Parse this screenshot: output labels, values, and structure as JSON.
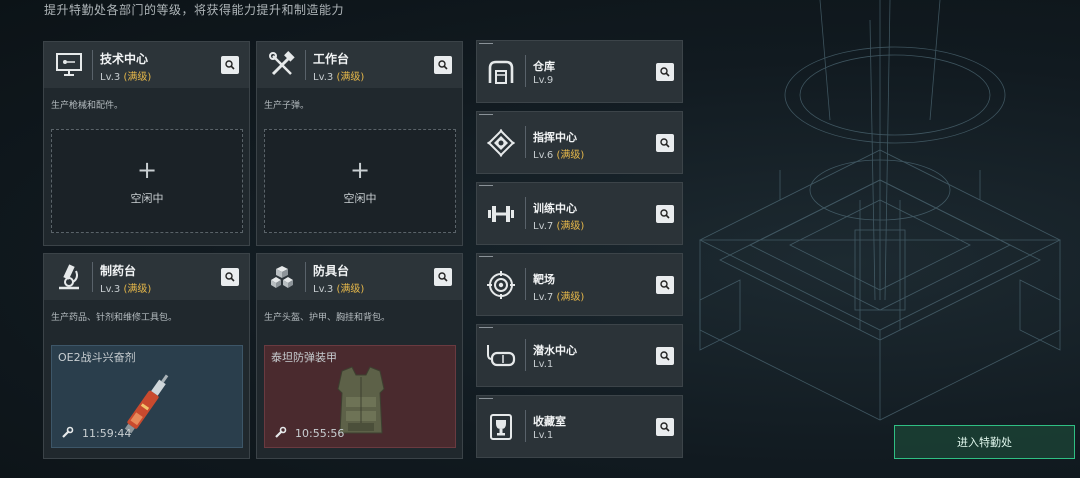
{
  "subtitle": "提升特勤处各部门的等级，将获得能力提升和制造能力",
  "cards": [
    {
      "name": "技术中心",
      "level": "Lv.3",
      "max": "(满级)",
      "desc": "生产枪械和配件。",
      "slot_text": "空闲中",
      "icon": "computer-icon"
    },
    {
      "name": "工作台",
      "level": "Lv.3",
      "max": "(满级)",
      "desc": "生产子弹。",
      "slot_text": "空闲中",
      "icon": "tools-icon"
    },
    {
      "name": "制药台",
      "level": "Lv.3",
      "max": "(满级)",
      "desc": "生产药品、针剂和维修工具包。",
      "product": "OE2战斗兴奋剂",
      "timer": "11:59:44",
      "icon": "microscope-icon"
    },
    {
      "name": "防具台",
      "level": "Lv.3",
      "max": "(满级)",
      "desc": "生产头盔、护甲、胸挂和背包。",
      "product": "泰坦防弹装甲",
      "timer": "10:55:56",
      "icon": "armor-blocks-icon"
    }
  ],
  "right_list": [
    {
      "name": "仓库",
      "level": "Lv.9",
      "max": "",
      "icon": "warehouse-icon"
    },
    {
      "name": "指挥中心",
      "level": "Lv.6",
      "max": "(满级)",
      "icon": "command-icon"
    },
    {
      "name": "训练中心",
      "level": "Lv.7",
      "max": "(满级)",
      "icon": "dumbbell-icon"
    },
    {
      "name": "靶场",
      "level": "Lv.7",
      "max": "(满级)",
      "icon": "target-icon"
    },
    {
      "name": "潜水中心",
      "level": "Lv.1",
      "max": "",
      "icon": "diving-mask-icon"
    },
    {
      "name": "收藏室",
      "level": "Lv.1",
      "max": "",
      "icon": "trophy-icon"
    }
  ],
  "enter_button": "进入特勤处",
  "colors": {
    "accent": "#2fbf83",
    "max_level": "#e6b84a",
    "pharma_bg": "#2a3e4c",
    "armor_bg": "#4a2a2e"
  }
}
